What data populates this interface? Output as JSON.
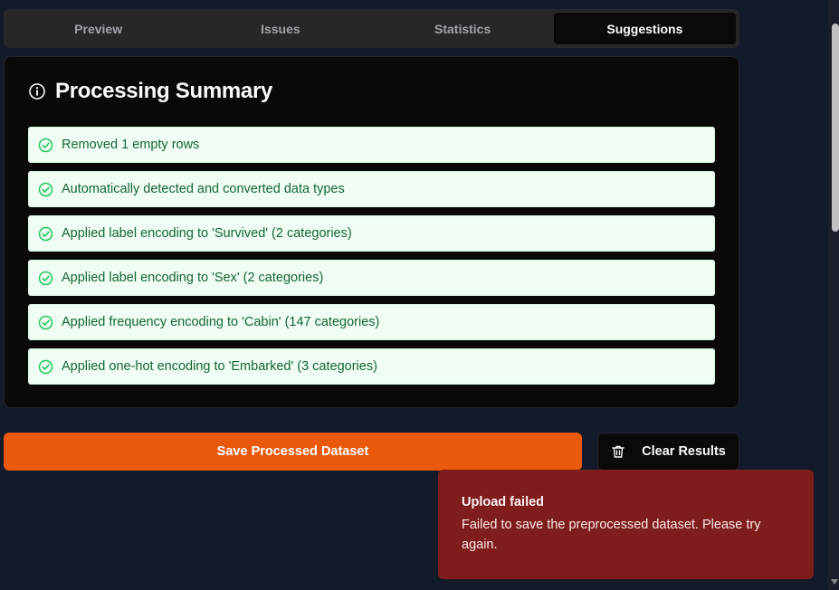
{
  "tabs": [
    {
      "label": "Preview",
      "active": false
    },
    {
      "label": "Issues",
      "active": false
    },
    {
      "label": "Statistics",
      "active": false
    },
    {
      "label": "Suggestions",
      "active": true
    }
  ],
  "summary": {
    "title": "Processing Summary",
    "icon": "info-icon",
    "items": [
      {
        "text": "Removed 1 empty rows",
        "icon": "check-circle-icon"
      },
      {
        "text": "Automatically detected and converted data types",
        "icon": "check-circle-icon"
      },
      {
        "text": "Applied label encoding to 'Survived' (2 categories)",
        "icon": "check-circle-icon"
      },
      {
        "text": "Applied label encoding to 'Sex' (2 categories)",
        "icon": "check-circle-icon"
      },
      {
        "text": "Applied frequency encoding to 'Cabin' (147 categories)",
        "icon": "check-circle-icon"
      },
      {
        "text": "Applied one-hot encoding to 'Embarked' (3 categories)",
        "icon": "check-circle-icon"
      }
    ]
  },
  "actions": {
    "save_label": "Save Processed Dataset",
    "clear_label": "Clear Results",
    "clear_icon": "trash-icon"
  },
  "toast": {
    "title": "Upload failed",
    "message": "Failed to save the preprocessed dataset. Please try again."
  },
  "colors": {
    "page_bg": "#131a2a",
    "accent_orange": "#ea580c",
    "success_bg": "#effdf3",
    "success_text": "#166534",
    "success_icon": "#22c55e",
    "error_bg": "#7f1d1d"
  }
}
